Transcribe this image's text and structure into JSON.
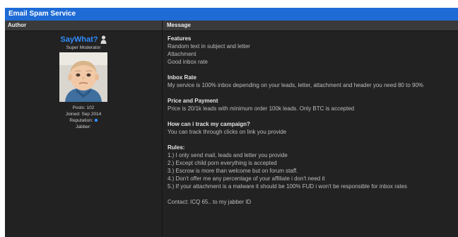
{
  "thread": {
    "title": "Email Spam Service"
  },
  "columns": {
    "author": "Author",
    "message": "Message"
  },
  "post": {
    "author": {
      "username": "SayWhat?",
      "rank": "Super Moderator",
      "posts": "Posts: 102",
      "joined": "Joined: Sep 2014",
      "reputation": "Reputation:",
      "jabber": "Jabber:"
    },
    "sections": [
      {
        "title": "Features",
        "lines": [
          "Random text in subject and letter",
          "Attachment",
          "Good inbox rate"
        ]
      },
      {
        "title": "Inbox Rate",
        "lines": [
          "My service is 100% inbox depending on your leads, letter, attachment and header you need 80 to 90%"
        ]
      },
      {
        "title": "Price and Payment",
        "lines": [
          "Price is 20/1k leads with minimum order 100k leads. Only BTC is accepted"
        ]
      },
      {
        "title": "How can i track my campaign?",
        "lines": [
          "You can track through clicks on link you provide"
        ]
      },
      {
        "title": "Rules:",
        "lines": [
          "1.) I only send mail, leads and letter you provide",
          "2.) Except child porn everything is accepted",
          "3.) Escrow is more than welcome but on forum staff.",
          "4.) Don't offer me any percentage of your affiliate i don't need it",
          "5.) If your attachment is a malware it should be 100% FUD i won't be responsible for inbox rates"
        ]
      },
      {
        "title": "",
        "lines": [
          "Contact: ICQ 65.. to my jabber ID"
        ]
      }
    ]
  },
  "colors": {
    "header": "#1e6bd6",
    "username": "#2f8cff",
    "background": "#222222"
  }
}
